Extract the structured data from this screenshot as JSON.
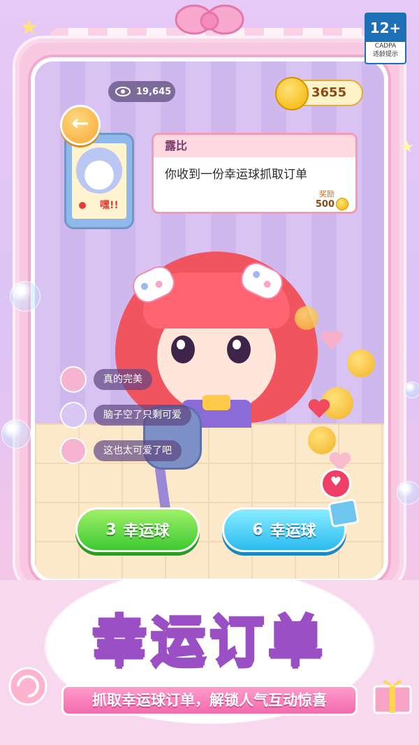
{
  "age_rating": {
    "number": "12+",
    "org": "CADPA",
    "label": "适龄提示"
  },
  "stats": {
    "views": "19,645",
    "coins": "3655"
  },
  "order_card": {
    "sender": "露比",
    "message": "你收到一份幸运球抓取订单",
    "reward_label": "奖励",
    "reward_value": "500"
  },
  "phone": {
    "caller_text": "嘿!!"
  },
  "comments": [
    {
      "text": "真的完美"
    },
    {
      "text": "脑子空了只剩可爱"
    },
    {
      "text": "这也太可爱了吧"
    }
  ],
  "buttons": {
    "option1": {
      "count": "3",
      "label": "幸运球"
    },
    "option2": {
      "count": "6",
      "label": "幸运球"
    }
  },
  "banner": {
    "title": "幸运订单",
    "subtitle": "抓取幸运球订单，解锁人气互动惊喜"
  },
  "colors": {
    "accent_pink": "#f59ab4",
    "button_green": "#3ec932",
    "button_blue": "#2bbbf0",
    "title_purple": "#9b4fc4"
  },
  "icons": [
    "eye-icon",
    "coin-icon",
    "back-arrow-icon",
    "heart-icon",
    "video-ad-icon",
    "bow-icon",
    "star-icon"
  ]
}
